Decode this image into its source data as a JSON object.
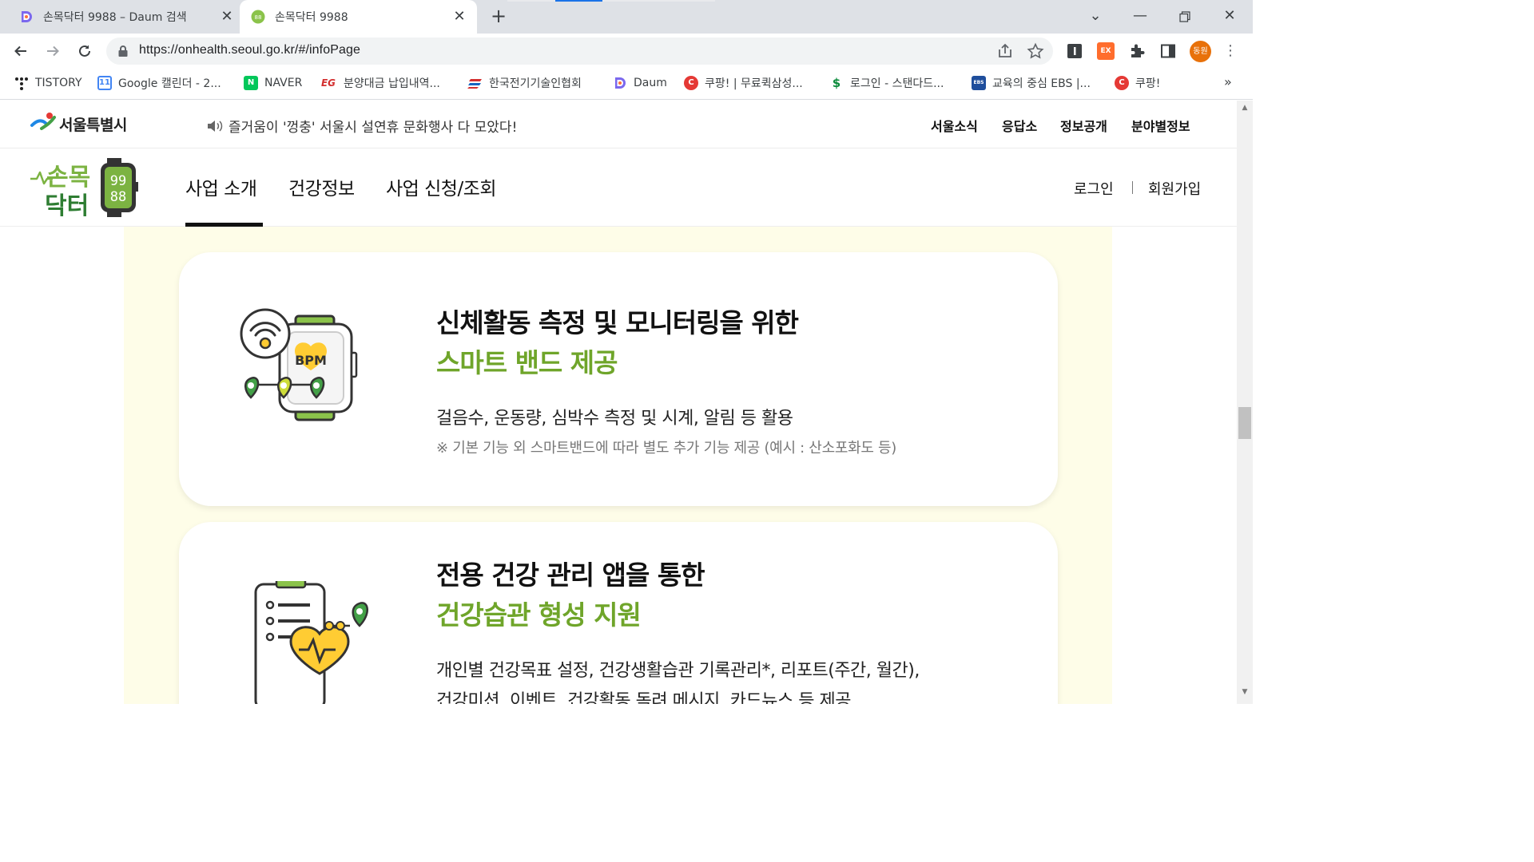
{
  "browser": {
    "tabs": [
      {
        "title": "손목닥터 9988 – Daum 검색",
        "active": false
      },
      {
        "title": "손목닥터 9988",
        "active": true
      }
    ],
    "url": "https://onhealth.seoul.go.kr/#/infoPage",
    "profile_label": "동원",
    "extension_ex_label": "EX",
    "bookmarks": [
      {
        "label": "TISTORY",
        "icon": "tistory-icon"
      },
      {
        "label": "Google 캘린더 - 2...",
        "icon": "google-calendar-icon",
        "icon_text": "11"
      },
      {
        "label": "NAVER",
        "icon": "naver-icon",
        "icon_text": "N"
      },
      {
        "label": "분양대금 납입내역...",
        "icon": "eg-icon",
        "icon_text": "EG"
      },
      {
        "label": "한국전기기술인협회",
        "icon": "kea-icon"
      },
      {
        "label": "Daum",
        "icon": "daum-icon",
        "icon_text": "D"
      },
      {
        "label": "쿠팡! | 무료퀵삼성...",
        "icon": "coupang-icon",
        "icon_text": "C"
      },
      {
        "label": "로그인 - 스탠다드...",
        "icon": "standard-icon",
        "icon_text": "$"
      },
      {
        "label": "교육의 중심 EBS |...",
        "icon": "ebs-icon",
        "icon_text": "EBS"
      },
      {
        "label": "쿠팡!",
        "icon": "coupang-icon",
        "icon_text": "C"
      }
    ],
    "bookmarks_more": "»"
  },
  "site": {
    "seoul_logo_text": "서울특별시",
    "notice": "즐거움이 '껑충' 서울시 설연휴 문화행사 다 모았다!",
    "util_nav": [
      "서울소식",
      "응답소",
      "정보공개",
      "분야별정보"
    ],
    "brand_line1": "손목",
    "brand_line2": "닥터",
    "brand_watch_digits_top": "99",
    "brand_watch_digits_bottom": "88",
    "gnb": [
      "사업 소개",
      "건강정보",
      "사업 신청/조회"
    ],
    "gnb_active": 0,
    "auth": [
      "로그인",
      "회원가입"
    ]
  },
  "cards": [
    {
      "title": "신체활동 측정 및 모니터링을 위한",
      "subtitle": "스마트 밴드 제공",
      "description": "걸음수, 운동량, 심박수 측정 및 시계, 알림 등 활용",
      "note": "※ 기본 기능 외 스마트밴드에 따라 별도 추가 기능 제공 (예시 : 산소포화도 등)",
      "illustration_label": "BPM"
    },
    {
      "title": "전용 건강 관리 앱을 통한",
      "subtitle": "건강습관 형성 지원",
      "description": "개인별 건강목표 설정, 건강생활습관 기록관리*, 리포트(주간, 월간),",
      "description2": "건강미션, 이벤트, 건강활동 독려 메시지, 카드뉴스 등 제공"
    }
  ],
  "colors": {
    "accent_green": "#6fa52a",
    "content_bg": "#fefde8",
    "brand_green": "#2e8b3a"
  }
}
